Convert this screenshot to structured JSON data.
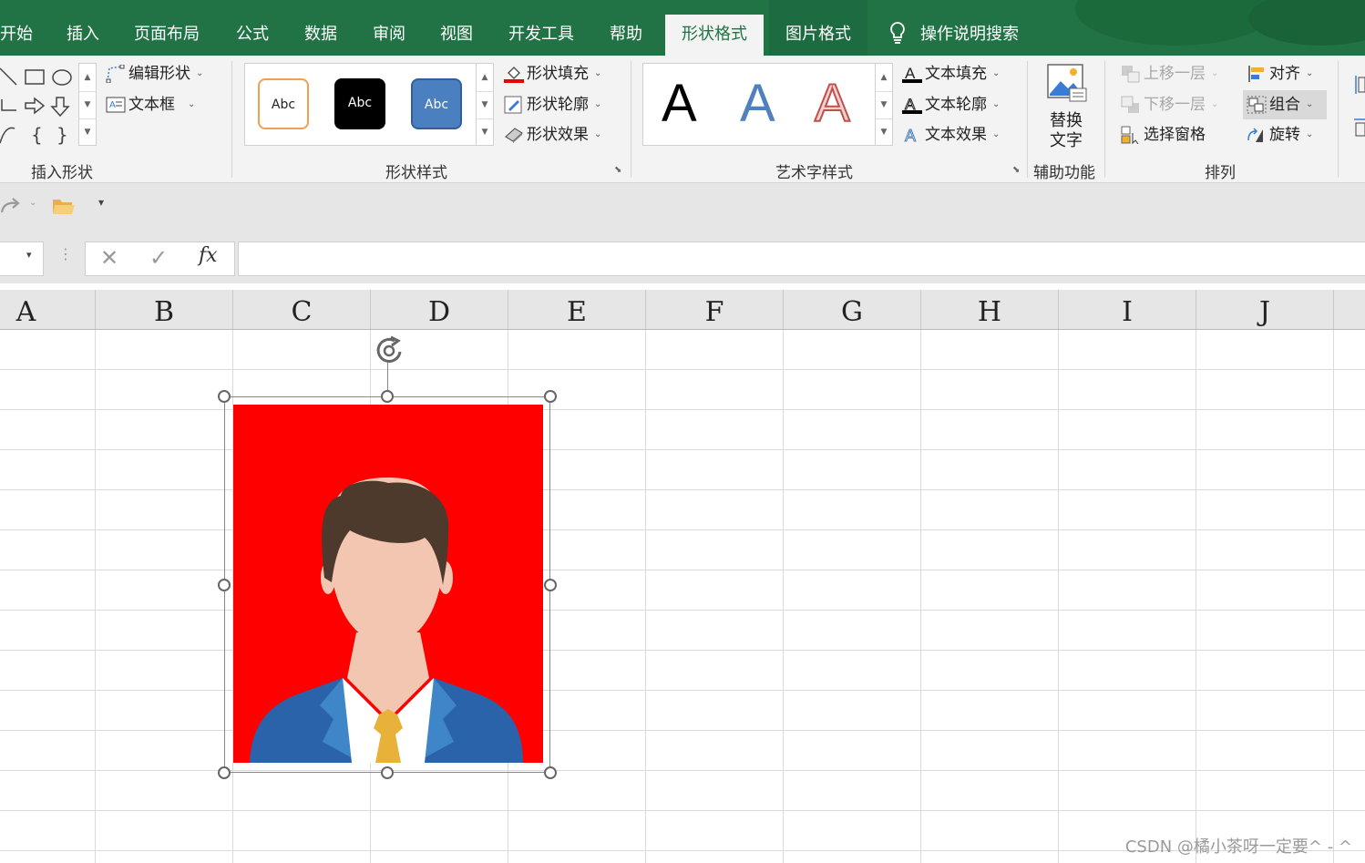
{
  "ribbon_tabs": [
    "开始",
    "插入",
    "页面布局",
    "公式",
    "数据",
    "审阅",
    "视图",
    "开发工具",
    "帮助",
    "形状格式",
    "图片格式"
  ],
  "active_tab": "形状格式",
  "tell_me": "操作说明搜索",
  "groups": {
    "insert_shapes": {
      "label": "插入形状",
      "edit_shape": "编辑形状",
      "text_box": "文本框"
    },
    "shape_styles": {
      "label": "形状样式",
      "fill": "形状填充",
      "outline": "形状轮廓",
      "effects": "形状效果",
      "preset_text": "Abc"
    },
    "wordart": {
      "label": "艺术字样式",
      "sample": "A",
      "fill": "文本填充",
      "outline": "文本轮廓",
      "effects": "文本效果"
    },
    "accessibility": {
      "label": "辅助功能",
      "alt_text_line1": "替换",
      "alt_text_line2": "文字"
    },
    "arrange": {
      "label": "排列",
      "bring_forward": "上移一层",
      "send_backward": "下移一层",
      "selection_pane": "选择窗格",
      "align": "对齐",
      "group": "组合",
      "rotate": "旋转"
    }
  },
  "formula_bar": {
    "fx": "fx",
    "value": ""
  },
  "columns": [
    "A",
    "B",
    "C",
    "D",
    "E",
    "F",
    "G",
    "H",
    "I",
    "J"
  ],
  "colors": {
    "ribbon_green": "#217346",
    "picture_bg": "#ff0000",
    "suit": "#2a63aa",
    "tie": "#e8b23a",
    "hair": "#4e3a2c",
    "skin": "#f2c6b0"
  },
  "watermark": "CSDN @橘小茶呀一定要^ - ^"
}
